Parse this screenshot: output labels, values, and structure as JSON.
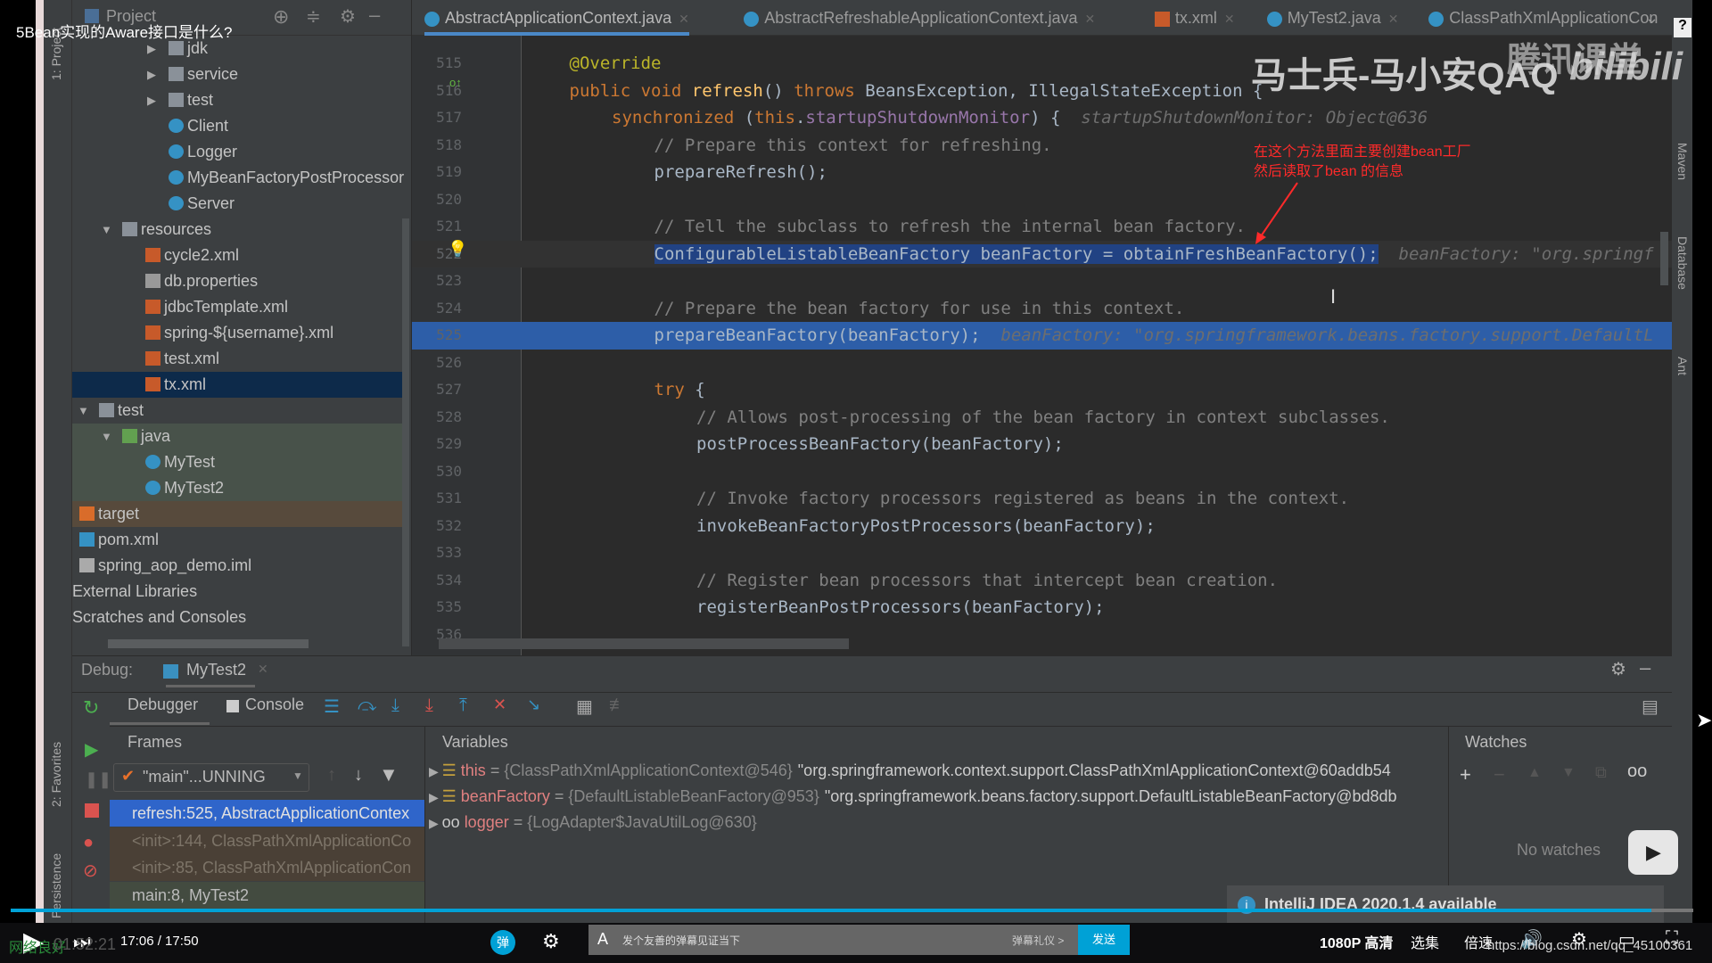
{
  "video_title": "5Bean实现的Aware接口是什么?",
  "watermark": {
    "author": "马士兵-马小安QAQ",
    "platform": "腾讯课堂",
    "logo": "bilibili"
  },
  "annotation": {
    "line1": "在这个方法里面主要创建bean工厂",
    "line2": "然后读取了bean 的信息",
    "color": "#ff2a2a"
  },
  "left_stripe": {
    "project": "1: Project",
    "favorites": "2: Favorites",
    "persistence": "Persistence"
  },
  "right_stripe": [
    "Maven",
    "Database",
    "Ant"
  ],
  "project_panel": {
    "title": "Project",
    "items": [
      {
        "label": "jdk",
        "depth": 3,
        "arrow": "right",
        "icon": "folder"
      },
      {
        "label": "service",
        "depth": 3,
        "arrow": "right",
        "icon": "folder"
      },
      {
        "label": "test",
        "depth": 3,
        "arrow": "right",
        "icon": "folder"
      },
      {
        "label": "Client",
        "depth": 3,
        "icon": "class"
      },
      {
        "label": "Logger",
        "depth": 3,
        "icon": "class"
      },
      {
        "label": "MyBeanFactoryPostProcessor",
        "depth": 3,
        "icon": "class"
      },
      {
        "label": "Server",
        "depth": 3,
        "icon": "class"
      },
      {
        "label": "resources",
        "depth": 1,
        "arrow": "down",
        "icon": "resources-folder"
      },
      {
        "label": "cycle2.xml",
        "depth": 2,
        "icon": "spring-xml"
      },
      {
        "label": "db.properties",
        "depth": 2,
        "icon": "properties"
      },
      {
        "label": "jdbcTemplate.xml",
        "depth": 2,
        "icon": "spring-xml"
      },
      {
        "label": "spring-${username}.xml",
        "depth": 2,
        "icon": "spring-xml"
      },
      {
        "label": "test.xml",
        "depth": 2,
        "icon": "spring-xml"
      },
      {
        "label": "tx.xml",
        "depth": 2,
        "icon": "spring-xml",
        "selected": true
      },
      {
        "label": "test",
        "depth": 0,
        "arrow": "down",
        "icon": "folder"
      },
      {
        "label": "java",
        "depth": 1,
        "arrow": "down",
        "icon": "test-folder",
        "tint": "test"
      },
      {
        "label": "MyTest",
        "depth": 2,
        "icon": "class",
        "tint": "test"
      },
      {
        "label": "MyTest2",
        "depth": 2,
        "icon": "class",
        "tint": "test"
      },
      {
        "label": "target",
        "depth": -1,
        "icon": "excluded-folder",
        "tint": "excluded"
      },
      {
        "label": "pom.xml",
        "depth": -1,
        "icon": "maven"
      },
      {
        "label": "spring_aop_demo.iml",
        "depth": -1,
        "icon": "iml"
      },
      {
        "label": "External Libraries",
        "depth": -2
      },
      {
        "label": "Scratches and Consoles",
        "depth": -2
      }
    ]
  },
  "tabs": [
    {
      "label": "AbstractApplicationContext.java",
      "active": true
    },
    {
      "label": "AbstractRefreshableApplicationContext.java"
    },
    {
      "label": "tx.xml"
    },
    {
      "label": "MyTest2.java"
    },
    {
      "label": "ClassPathXmlApplicationCon"
    }
  ],
  "editor": {
    "lines": [
      {
        "n": "515",
        "indent": 1,
        "seg": [
          [
            "@Override",
            "an"
          ]
        ]
      },
      {
        "n": "516",
        "indent": 1,
        "seg": [
          [
            "public void ",
            "kw"
          ],
          [
            "refresh",
            "fn"
          ],
          [
            "() ",
            "tx"
          ],
          [
            "throws ",
            "kw"
          ],
          [
            "BeansException, IllegalStateException {",
            "tx"
          ]
        ]
      },
      {
        "n": "517",
        "indent": 2,
        "seg": [
          [
            "synchronized ",
            "kw"
          ],
          [
            "(",
            "tx"
          ],
          [
            "this",
            "kw"
          ],
          [
            ".",
            "tx"
          ],
          [
            "startupShutdownMonitor",
            "fl"
          ],
          [
            ") {  ",
            "tx"
          ],
          [
            "startupShutdownMonitor: Object@636",
            "hint"
          ]
        ]
      },
      {
        "n": "518",
        "indent": 3,
        "seg": [
          [
            "// Prepare this context for refreshing.",
            "cm"
          ]
        ]
      },
      {
        "n": "519",
        "indent": 3,
        "seg": [
          [
            "prepareRefresh();",
            "tx"
          ]
        ]
      },
      {
        "n": "520",
        "indent": 0,
        "seg": []
      },
      {
        "n": "521",
        "indent": 3,
        "seg": [
          [
            "// Tell the subclass to refresh the internal bean factory.",
            "cm"
          ]
        ]
      },
      {
        "n": "522",
        "indent": 3,
        "selected": true,
        "seg": [
          [
            "ConfigurableListableBeanFactory beanFactory = obtainFreshBeanFactory();",
            "tx"
          ],
          [
            "  beanFactory: \"org.springf",
            "hint"
          ]
        ]
      },
      {
        "n": "523",
        "indent": 0,
        "seg": []
      },
      {
        "n": "524",
        "indent": 3,
        "seg": [
          [
            "// Prepare the bean factory for use in this context.",
            "cm"
          ]
        ]
      },
      {
        "n": "525",
        "indent": 3,
        "execution": true,
        "seg": [
          [
            "prepareBeanFactory(beanFactory);",
            "tx"
          ],
          [
            "  beanFactory: \"org.springframework.beans.factory.support.DefaultL",
            "hint"
          ]
        ]
      },
      {
        "n": "526",
        "indent": 0,
        "seg": []
      },
      {
        "n": "527",
        "indent": 3,
        "seg": [
          [
            "try ",
            "kw"
          ],
          [
            "{",
            "tx"
          ]
        ]
      },
      {
        "n": "528",
        "indent": 4,
        "seg": [
          [
            "// Allows post-processing of the bean factory in context subclasses.",
            "cm"
          ]
        ]
      },
      {
        "n": "529",
        "indent": 4,
        "seg": [
          [
            "postProcessBeanFactory(beanFactory);",
            "tx"
          ]
        ]
      },
      {
        "n": "530",
        "indent": 0,
        "seg": []
      },
      {
        "n": "531",
        "indent": 4,
        "seg": [
          [
            "// Invoke factory processors registered as beans in the context.",
            "cm"
          ]
        ]
      },
      {
        "n": "532",
        "indent": 4,
        "seg": [
          [
            "invokeBeanFactoryPostProcessors(beanFactory);",
            "tx"
          ]
        ]
      },
      {
        "n": "533",
        "indent": 0,
        "seg": []
      },
      {
        "n": "534",
        "indent": 4,
        "seg": [
          [
            "// Register bean processors that intercept bean creation.",
            "cm"
          ]
        ]
      },
      {
        "n": "535",
        "indent": 4,
        "seg": [
          [
            "registerBeanPostProcessors(beanFactory);",
            "tx"
          ]
        ]
      },
      {
        "n": "536",
        "indent": 0,
        "seg": []
      }
    ]
  },
  "debug": {
    "label": "Debug:",
    "session": "MyTest2",
    "tabs": [
      "Debugger",
      "Console"
    ],
    "frames_title": "Frames",
    "thread": "\"main\"...UNNING",
    "frames": [
      {
        "label": "refresh:525, AbstractApplicationContex",
        "state": "current"
      },
      {
        "label": "<init>:144, ClassPathXmlApplicationCo",
        "state": "library"
      },
      {
        "label": "<init>:85, ClassPathXmlApplicationCon",
        "state": "library"
      },
      {
        "label": "main:8, MyTest2",
        "state": "test"
      }
    ],
    "variables_title": "Variables",
    "variables": [
      {
        "name": "this",
        "value": "{ClassPathXmlApplicationContext@546}",
        "detail": "\"org.springframework.context.support.ClassPathXmlApplicationContext@60addb54"
      },
      {
        "name": "beanFactory",
        "value": "{DefaultListableBeanFactory@953}",
        "detail": "\"org.springframework.beans.factory.support.DefaultListableBeanFactory@bd8db"
      },
      {
        "name": "logger",
        "value": "{LogAdapter$JavaUtilLog@630}",
        "detail": ""
      }
    ],
    "watches_title": "Watches",
    "no_watches": "No watches",
    "notification": "IntelliJ IDEA 2020.1.4 available"
  },
  "player": {
    "time": "17:06 / 17:50",
    "network": "网络良好",
    "elapsed_overlay": "01:52:21",
    "progress_pct": 97.5,
    "danmaku_placeholder": "发个友善的弹幕见证当下",
    "danmaku_etiquette": "弹幕礼仪 >",
    "send": "发送",
    "quality": "1080P 高清",
    "episodes": "选集",
    "speed": "倍速",
    "source_watermark": "https://blog.csdn.net/qq_45100361",
    "accent": "#00a1d6"
  }
}
